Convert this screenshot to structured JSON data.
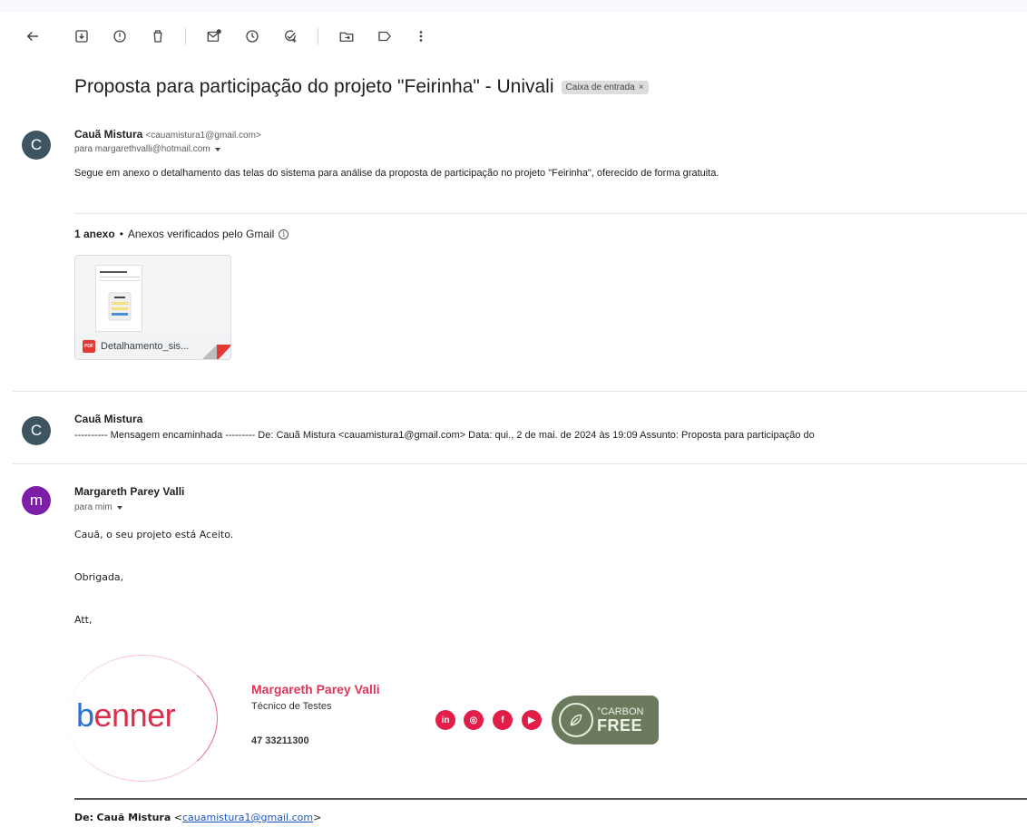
{
  "toolbar": {
    "icons": [
      "back-arrow-icon",
      "archive-icon",
      "report-spam-icon",
      "delete-icon",
      "mark-unread-icon",
      "snooze-icon",
      "add-to-tasks-icon",
      "move-to-icon",
      "label-icon",
      "more-options-icon"
    ]
  },
  "thread": {
    "subject": "Proposta para participação do projeto \"Feirinha\" - Univali",
    "label": "Caixa de entrada",
    "label_close": "×"
  },
  "messages": [
    {
      "avatar_letter": "C",
      "avatar_color": "#3c5561",
      "sender_name": "Cauã Mistura",
      "sender_email": "<cauamistura1@gmail.com>",
      "recipient": "para margarethvalli@hotmail.com",
      "body": "Segue em anexo o detalhamento das telas do sistema para análise da proposta de participação no projeto \"Feirinha\", oferecido de forma gratuita.",
      "attachments_count": "1 anexo",
      "attachments_separator": "•",
      "attachments_note": "Anexos verificados pelo Gmail",
      "attachment": {
        "type_badge": "PDF",
        "name": "Detalhamento_sis..."
      }
    },
    {
      "avatar_letter": "C",
      "avatar_color": "#3c5561",
      "sender_name": "Cauã Mistura",
      "snippet": "---------- Mensagem encaminhada --------- De: Cauã Mistura <cauamistura1@gmail.com> Data: qui., 2 de mai. de 2024 às 19:09 Assunto: Proposta para participação do"
    },
    {
      "avatar_letter": "m",
      "avatar_color": "#7c1ea8",
      "sender_name": "Margareth Parey Valli",
      "recipient": "para mim",
      "body_lines": [
        "Cauã, o seu projeto está Aceito.",
        "Obrigada,",
        "Att,"
      ],
      "signature": {
        "logo_first": "b",
        "logo_rest": "enner",
        "name": "Margareth Parey Valli",
        "role": "Técnico de Testes",
        "phone": "47 33211300",
        "social": [
          "in",
          "◎",
          "f",
          "▶"
        ],
        "carbon_top": "°CARBON",
        "carbon_bottom": "FREE"
      },
      "forward_from_label": "De:",
      "forward_from_name": "Cauã Mistura",
      "forward_from_email": "cauamistura1@gmail.com"
    }
  ],
  "colors": {
    "brand_red": "#e0345c",
    "link_blue": "#1a55c6",
    "carbon_green": "#6b7a5c"
  }
}
